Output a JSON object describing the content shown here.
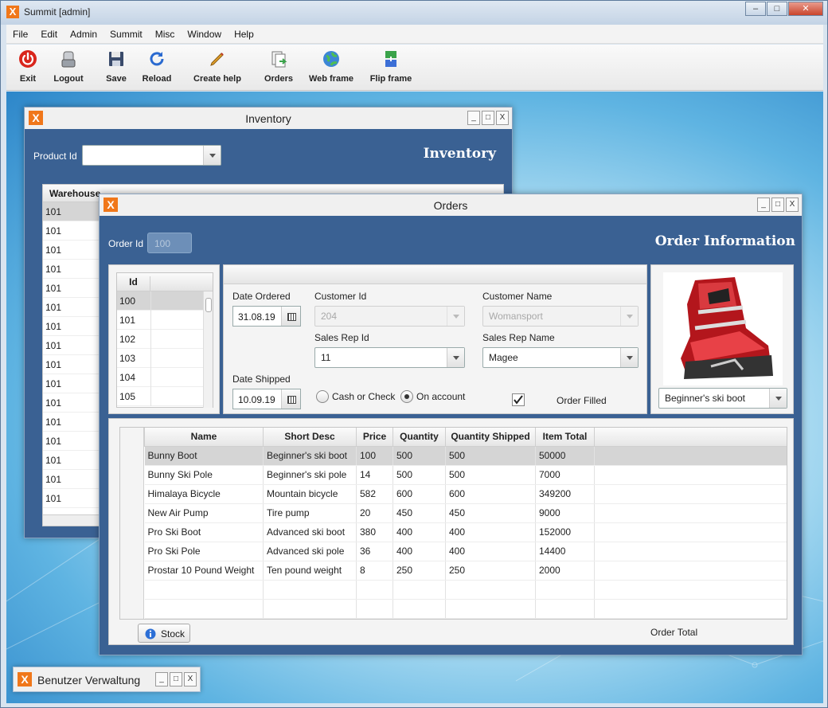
{
  "app": {
    "title": "Summit [admin]",
    "logo": "X"
  },
  "menu": [
    "File",
    "Edit",
    "Admin",
    "Summit",
    "Misc",
    "Window",
    "Help"
  ],
  "toolbar": [
    {
      "label": "Exit",
      "icon": "power-icon"
    },
    {
      "label": "Logout",
      "icon": "logout-icon"
    },
    {
      "label": "Save",
      "icon": "save-icon"
    },
    {
      "label": "Reload",
      "icon": "reload-icon"
    },
    {
      "label": "Create help",
      "icon": "create-help-icon"
    },
    {
      "label": "Orders",
      "icon": "orders-icon"
    },
    {
      "label": "Web frame",
      "icon": "web-frame-icon"
    },
    {
      "label": "Flip frame",
      "icon": "flip-frame-icon"
    }
  ],
  "inventory": {
    "title": "Inventory",
    "header": "Inventory",
    "product_id_label": "Product Id",
    "product_id_value": "",
    "column_header": "Warehouse",
    "rows": [
      "101",
      "101",
      "101",
      "101",
      "101",
      "101",
      "101",
      "101",
      "101",
      "101",
      "101",
      "101",
      "101",
      "101",
      "101",
      "101"
    ]
  },
  "orders": {
    "title": "Orders",
    "header": "Order Information",
    "order_id_label": "Order Id",
    "order_id_value": "100",
    "id_column": "Id",
    "ids": [
      "100",
      "101",
      "102",
      "103",
      "104",
      "105"
    ],
    "date_ordered_label": "Date Ordered",
    "date_ordered_value": "31.08.19",
    "date_shipped_label": "Date Shipped",
    "date_shipped_value": "10.09.19",
    "customer_id_label": "Customer Id",
    "customer_id_value": "204",
    "customer_name_label": "Customer Name",
    "customer_name_value": "Womansport",
    "sales_rep_id_label": "Sales Rep Id",
    "sales_rep_id_value": "11",
    "sales_rep_name_label": "Sales Rep Name",
    "sales_rep_name_value": "Magee",
    "payment_cash": "Cash or Check",
    "payment_account": "On account",
    "payment_selected": "On account",
    "order_filled_label": "Order Filled",
    "order_filled": true,
    "product_selection": "Beginner's ski boot",
    "items_columns": [
      "Name",
      "Short Desc",
      "Price",
      "Quantity",
      "Quantity Shipped",
      "Item Total"
    ],
    "items": [
      [
        "Bunny Boot",
        "Beginner's ski boot",
        "100",
        "500",
        "500",
        "50000"
      ],
      [
        "Bunny Ski Pole",
        "Beginner's ski pole",
        "14",
        "500",
        "500",
        "7000"
      ],
      [
        "Himalaya Bicycle",
        "Mountain bicycle",
        "582",
        "600",
        "600",
        "349200"
      ],
      [
        "New Air Pump",
        "Tire pump",
        "20",
        "450",
        "450",
        "9000"
      ],
      [
        "Pro Ski Boot",
        "Advanced ski boot",
        "380",
        "400",
        "400",
        "152000"
      ],
      [
        "Pro Ski Pole",
        "Advanced ski pole",
        "36",
        "400",
        "400",
        "14400"
      ],
      [
        "Prostar 10 Pound Weight",
        "Ten pound weight",
        "8",
        "250",
        "250",
        "2000"
      ]
    ],
    "stock_button": "Stock",
    "order_total_label": "Order Total"
  },
  "user_admin": {
    "title": "Benutzer Verwaltung"
  },
  "colors": {
    "frame_blue": "#3a6193",
    "accent_orange": "#f0771a",
    "selected_row": "#d5d5d5"
  }
}
